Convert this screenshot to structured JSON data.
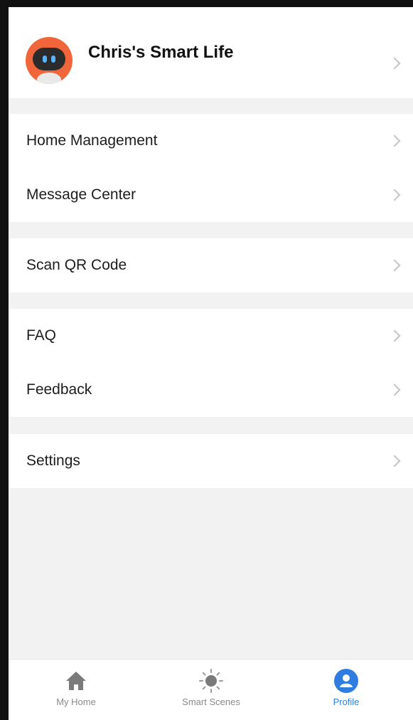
{
  "header": {
    "name": "Chris's Smart Life"
  },
  "groups": [
    {
      "items": [
        {
          "label": "Home Management"
        },
        {
          "label": "Message Center"
        }
      ]
    },
    {
      "items": [
        {
          "label": "Scan QR Code"
        }
      ]
    },
    {
      "items": [
        {
          "label": "FAQ"
        },
        {
          "label": "Feedback"
        }
      ]
    },
    {
      "items": [
        {
          "label": "Settings"
        }
      ]
    }
  ],
  "tabbar": {
    "tabs": [
      {
        "label": "My Home",
        "icon": "house-icon",
        "active": false
      },
      {
        "label": "Smart Scenes",
        "icon": "sun-icon",
        "active": false
      },
      {
        "label": "Profile",
        "icon": "person-icon",
        "active": true
      }
    ]
  },
  "colors": {
    "accent": "#2f7de1",
    "avatar": "#f0663a",
    "background": "#f2f2f2"
  }
}
